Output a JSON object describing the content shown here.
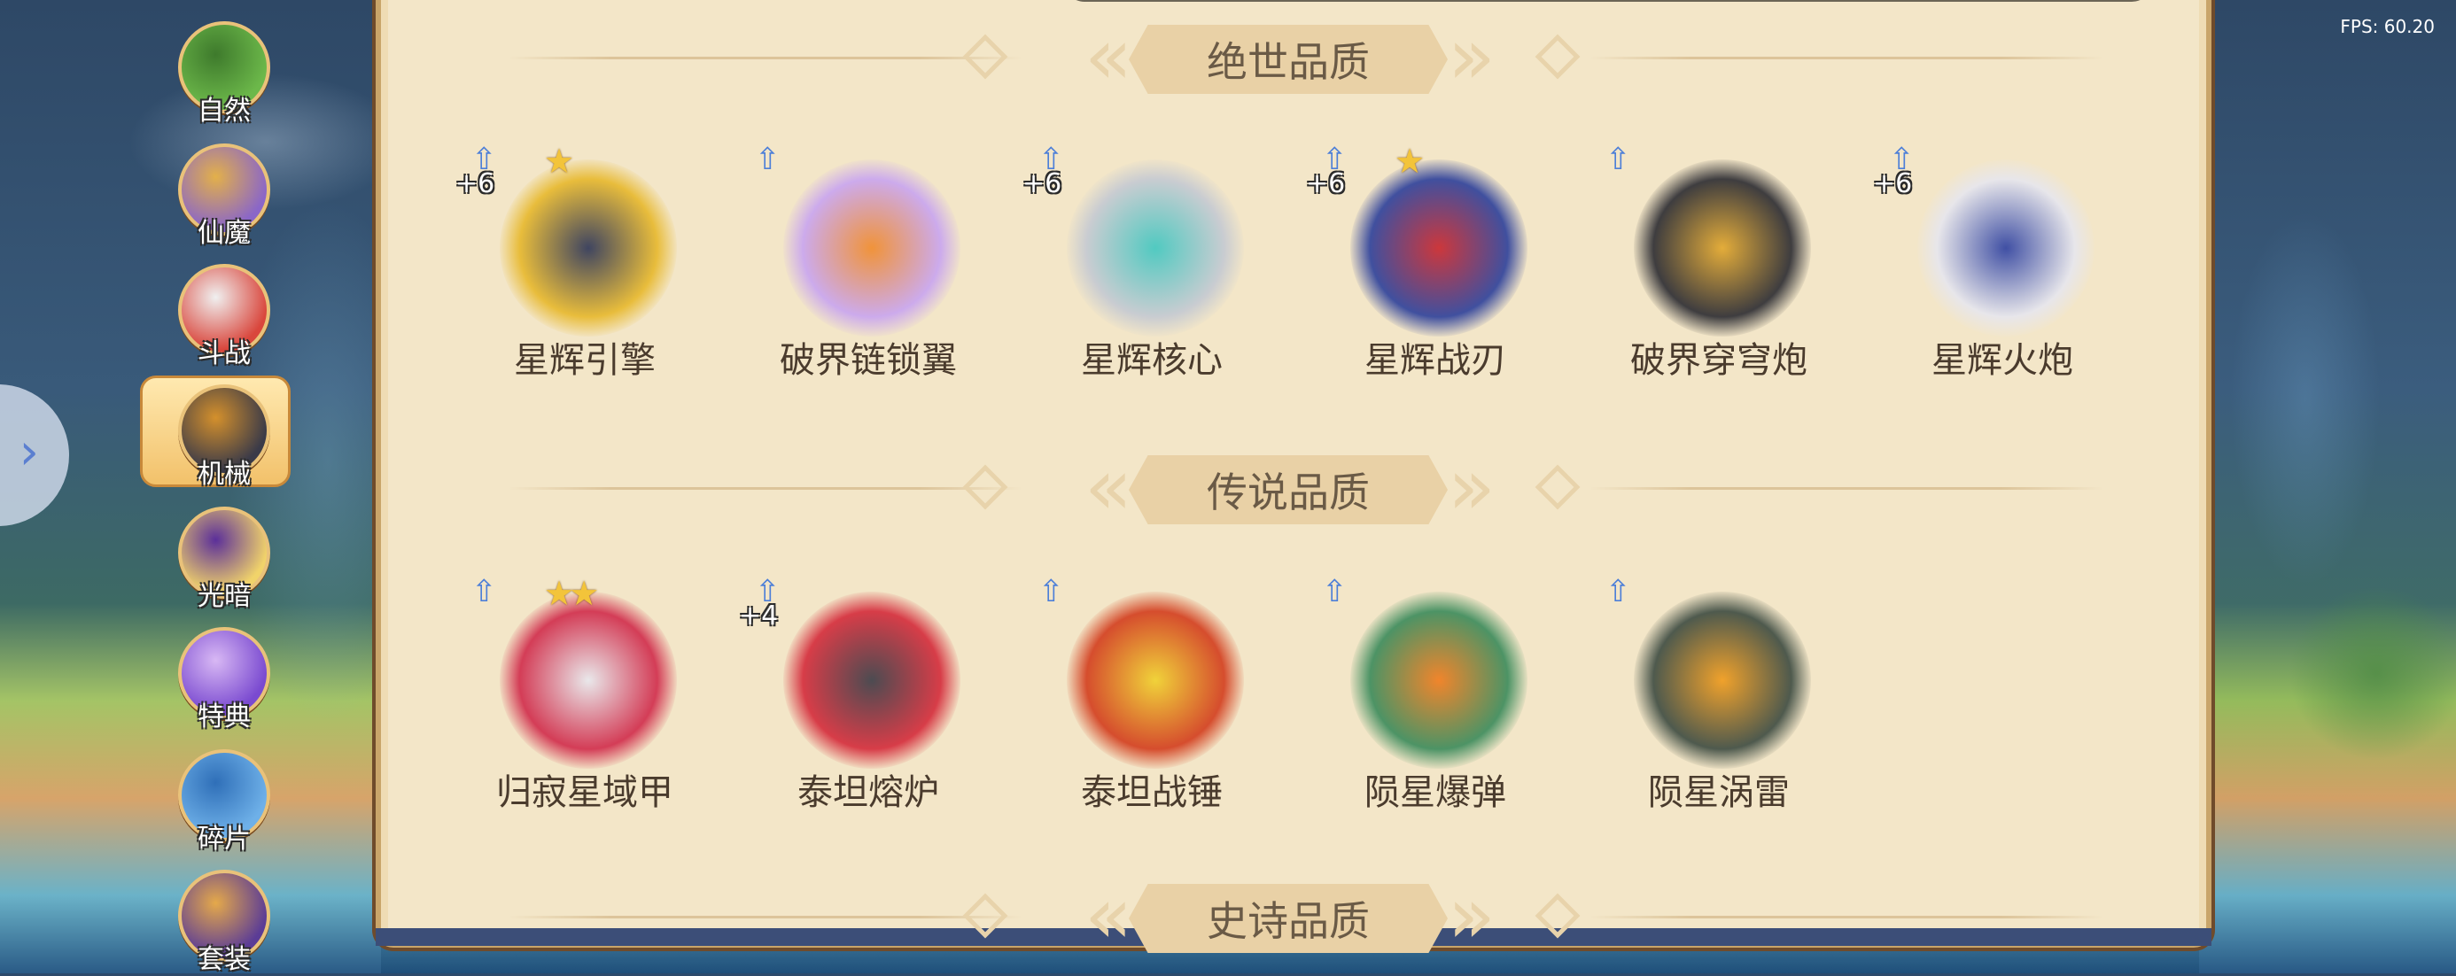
{
  "fps": "FPS: 60.20",
  "sidebar": {
    "categories": [
      {
        "label": "自然",
        "colors": [
          "#6cb84a",
          "#3e7a2c"
        ]
      },
      {
        "label": "仙魔",
        "colors": [
          "#8a66c8",
          "#e3b04a"
        ]
      },
      {
        "label": "斗战",
        "colors": [
          "#d9463c",
          "#f0f0f0"
        ]
      },
      {
        "label": "机械",
        "colors": [
          "#3a3a48",
          "#d4902c"
        ],
        "selected": true
      },
      {
        "label": "光暗",
        "colors": [
          "#f1d36a",
          "#5b2f9a"
        ]
      },
      {
        "label": "特典",
        "colors": [
          "#7a4ad0",
          "#d8b8f4"
        ]
      },
      {
        "label": "碎片",
        "colors": [
          "#6eb0e8",
          "#2f6fb8"
        ]
      },
      {
        "label": "套装",
        "colors": [
          "#5b3c96",
          "#e5a94a"
        ]
      }
    ],
    "toggle_icon": "chevron-right-icon"
  },
  "sections": [
    {
      "title": "绝世品质",
      "items": [
        {
          "name": "星辉引擎",
          "plus": "+6",
          "stars": "★",
          "colors": [
            "#2b3355",
            "#e7b82c"
          ]
        },
        {
          "name": "破界链锁翼",
          "plus": "",
          "stars": "",
          "colors": [
            "#f08a2a",
            "#c8a4f0"
          ]
        },
        {
          "name": "星辉核心",
          "plus": "+6",
          "stars": "",
          "colors": [
            "#3fc7c0",
            "#c4c9d2"
          ]
        },
        {
          "name": "星辉战刃",
          "plus": "+6",
          "stars": "★",
          "colors": [
            "#c8242c",
            "#2c3f9a"
          ]
        },
        {
          "name": "破界穿穹炮",
          "plus": "",
          "stars": "",
          "colors": [
            "#e2a62a",
            "#2a2a30"
          ]
        },
        {
          "name": "星辉火炮",
          "plus": "+6",
          "stars": "",
          "colors": [
            "#2c3fa0",
            "#e6e6ee"
          ]
        }
      ]
    },
    {
      "title": "传说品质",
      "items": [
        {
          "name": "归寂星域甲",
          "plus": "",
          "stars": "★★",
          "colors": [
            "#e8e8ee",
            "#d02a4a"
          ]
        },
        {
          "name": "泰坦熔炉",
          "plus": "+4",
          "stars": "",
          "colors": [
            "#3a3a44",
            "#d42a3a"
          ]
        },
        {
          "name": "泰坦战锤",
          "plus": "",
          "stars": "",
          "colors": [
            "#f0d02a",
            "#d23c1c"
          ]
        },
        {
          "name": "陨星爆弹",
          "plus": "",
          "stars": "",
          "colors": [
            "#f07a1a",
            "#3a8a5a"
          ]
        },
        {
          "name": "陨星涡雷",
          "plus": "",
          "stars": "",
          "colors": [
            "#f09a1a",
            "#3c4a40"
          ]
        }
      ]
    },
    {
      "title": "史诗品质",
      "items": []
    }
  ],
  "upgrade_icon": "upgrade-arrow-icon"
}
